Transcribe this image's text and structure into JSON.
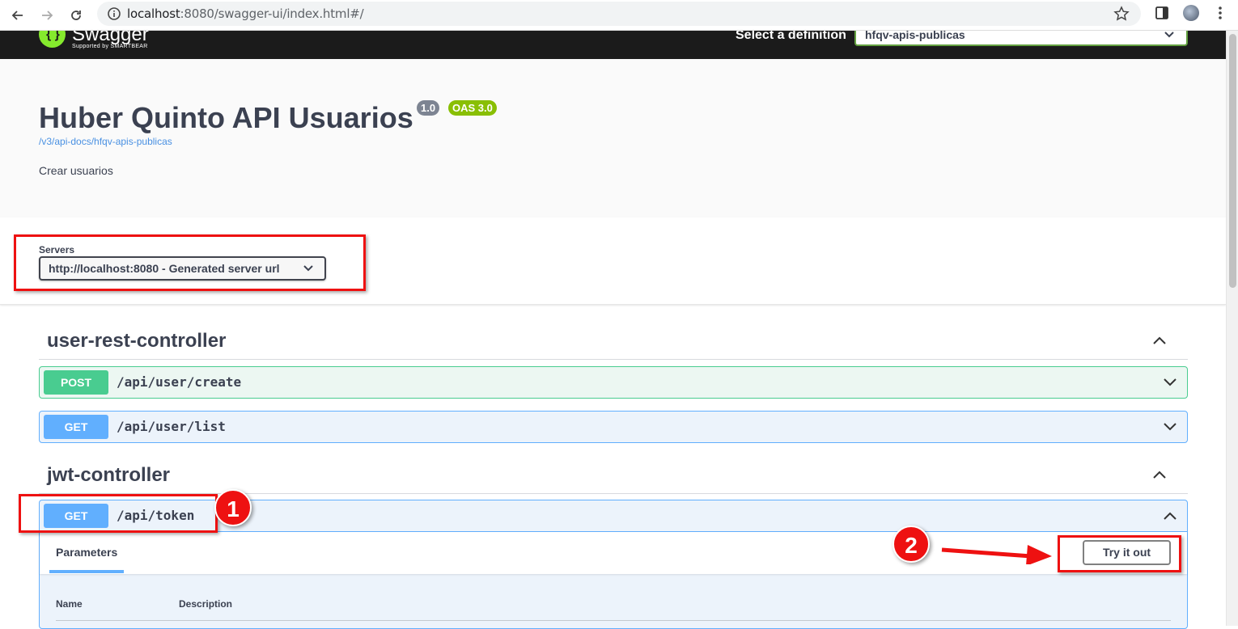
{
  "browser": {
    "url_host": "localhost",
    "url_rest": ":8080/swagger-ui/index.html#/"
  },
  "topbar": {
    "logo_text": "Swagger",
    "logo_sub": "Supported by SMARTBEAR",
    "definition_label": "Select a definition",
    "definition_value": "hfqv-apis-publicas"
  },
  "info": {
    "title": "Huber Quinto API Usuarios",
    "version_badge": "1.0",
    "oas_badge": "OAS 3.0",
    "docs_link": "/v3/api-docs/hfqv-apis-publicas",
    "description": "Crear usuarios"
  },
  "servers": {
    "label": "Servers",
    "selected": "http://localhost:8080 - Generated server url"
  },
  "sections": [
    {
      "name": "user-rest-controller",
      "operations": [
        {
          "method": "POST",
          "path": "/api/user/create"
        },
        {
          "method": "GET",
          "path": "/api/user/list"
        }
      ]
    },
    {
      "name": "jwt-controller",
      "operations": [
        {
          "method": "GET",
          "path": "/api/token"
        }
      ]
    }
  ],
  "expanded_op": {
    "parameters_tab": "Parameters",
    "try_button": "Try it out",
    "col_name": "Name",
    "col_description": "Description"
  },
  "annotations": {
    "step1": "1",
    "step2": "2"
  },
  "colors": {
    "post": "#49cc90",
    "get": "#61affe",
    "highlight": "#ee1111"
  }
}
